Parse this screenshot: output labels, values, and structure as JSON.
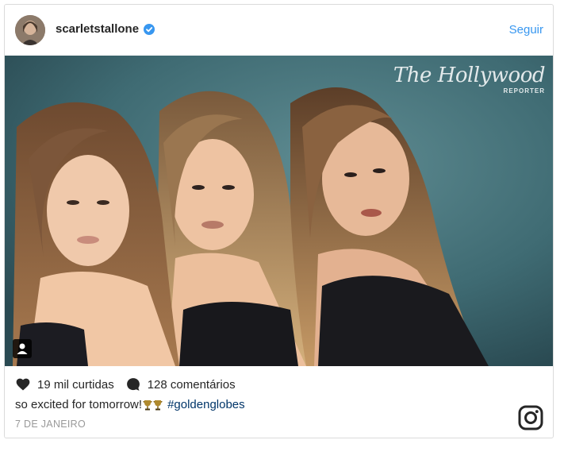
{
  "header": {
    "username": "scarletstallone",
    "follow_label": "Seguir",
    "verified_icon": "verified-badge-icon"
  },
  "photo": {
    "watermark_main": "The Hollywood",
    "watermark_sub": "REPORTER",
    "tag_icon": "user-tag-icon"
  },
  "actions": {
    "likes": "19 mil curtidas",
    "comments": "128 comentários"
  },
  "caption": {
    "text": "so excited for tomorrow!",
    "hashtag": "#goldenglobes"
  },
  "date": "7 DE JANEIRO",
  "colors": {
    "accent": "#3897f0",
    "hashtag": "#003569",
    "text": "#262626",
    "muted": "#999999",
    "photo_background": "#3f6b73"
  }
}
